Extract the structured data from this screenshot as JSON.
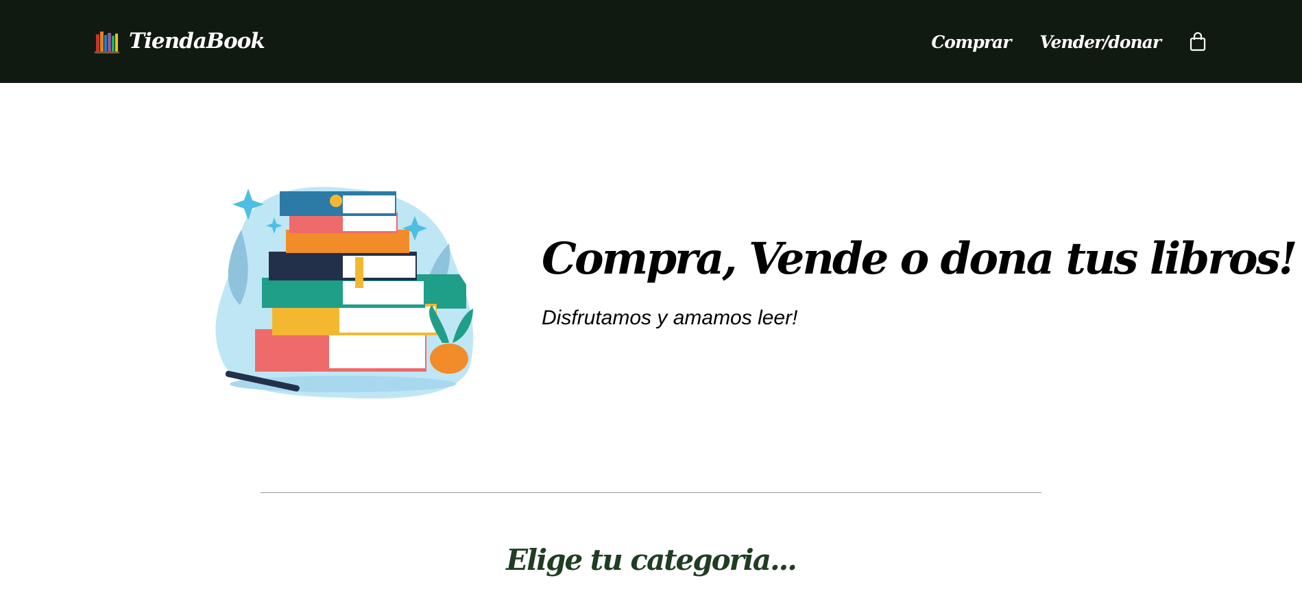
{
  "header": {
    "brand": "TiendaBook",
    "logo_icon": "books-shelf-icon",
    "nav": [
      {
        "label": "Comprar"
      },
      {
        "label": "Vender/donar"
      }
    ],
    "cart_icon": "shopping-bag-icon"
  },
  "hero": {
    "title": "Compra, Vende o dona tus libros!",
    "subtitle": "Disfrutamos y amamos leer!",
    "illustration": "stack-of-books-illustration"
  },
  "categories": {
    "title": "Elige tu categoria..."
  },
  "colors": {
    "navbar": "#111a11",
    "section_title": "#1f3d22"
  }
}
